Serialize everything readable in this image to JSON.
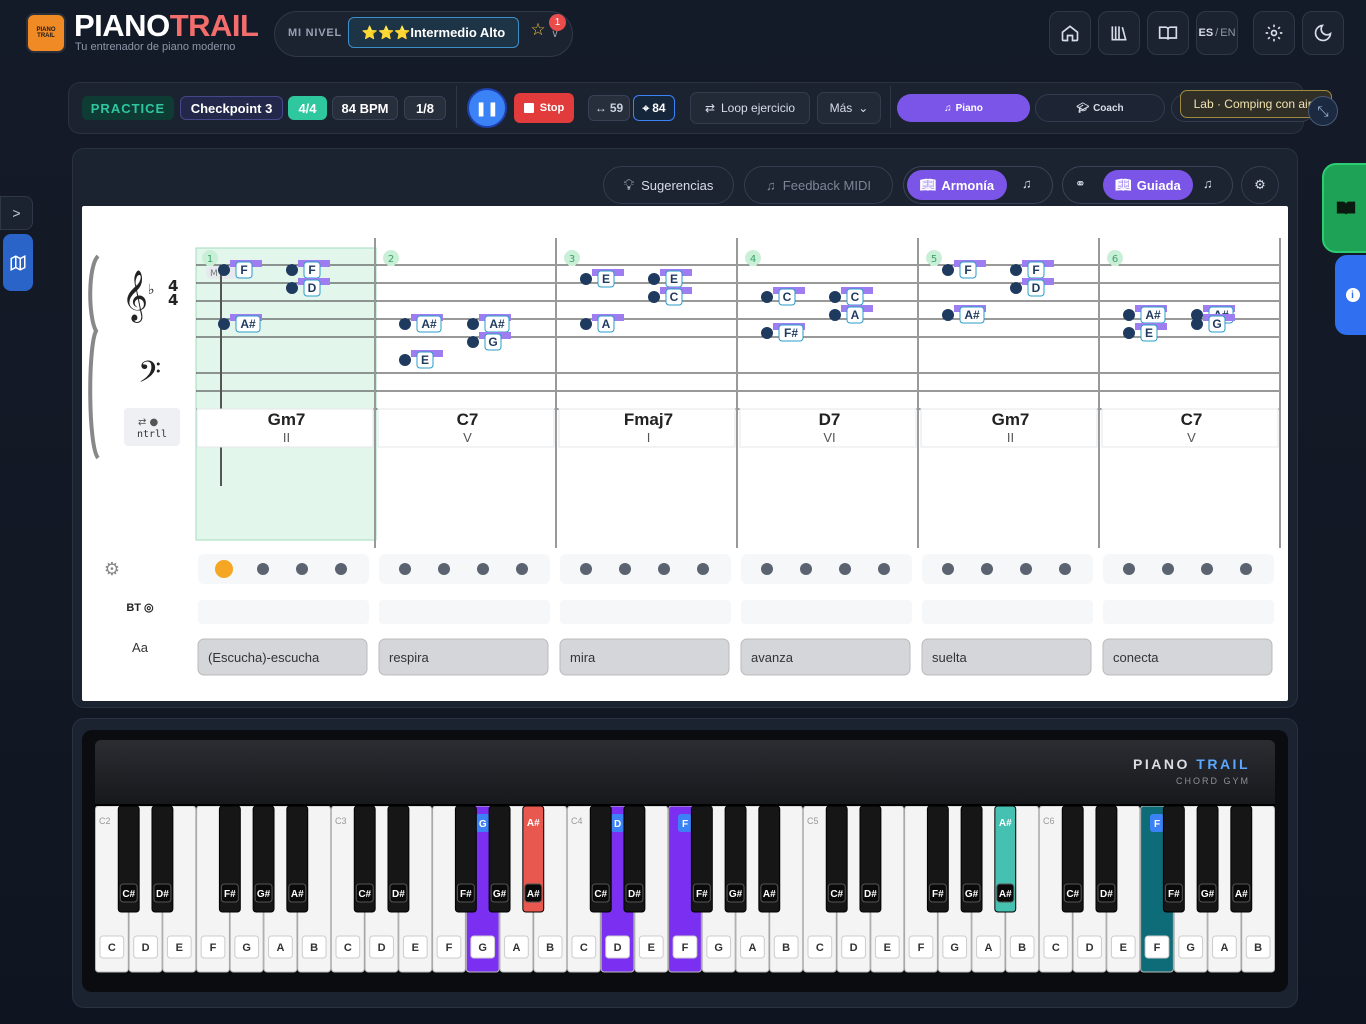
{
  "header": {
    "brand_part1": "PIANO",
    "brand_part2": "TRAIL",
    "logo_text1": "PIANO",
    "logo_text2": "TRAIL",
    "tagline": "Tu entrenador de piano moderno",
    "level_label": "MI NIVEL",
    "level_value": "⭐⭐⭐Intermedio Alto",
    "notification_count": "1",
    "lang_active": "ES",
    "lang_sep": "/",
    "lang_other": "EN",
    "icons": [
      "home-icon",
      "library-icon",
      "book-icon",
      "gear-icon",
      "moon-icon"
    ]
  },
  "transport": {
    "practice": "PRACTICE",
    "checkpoint": "Checkpoint 3",
    "meter": "4/4",
    "bpm": "84 BPM",
    "subdivision": "1/8",
    "stop": "Stop",
    "loop_count": "59",
    "sync_value": "84",
    "loop_label": "Loop ejercicio",
    "more_label": "Más",
    "tabs": [
      "Piano",
      "Coach"
    ],
    "lab_tooltip": "Lab · Comping con aire"
  },
  "filters": {
    "suggestions": "Sugerencias",
    "midi_feedback": "Feedback MIDI",
    "harmony": "Armonía",
    "guided": "Guiada"
  },
  "score": {
    "clef_mode_label": "ntrll",
    "octave_tag": "M",
    "octave_label": "O4",
    "measures": [
      {
        "number": "1",
        "chord": "Gm7",
        "roman": "II",
        "lyric": "(Escucha)-escucha",
        "notes": [
          {
            "label": "F",
            "pos": 0,
            "step": 0
          },
          {
            "label": "F",
            "pos": 1,
            "step": 0
          },
          {
            "label": "D",
            "pos": 1,
            "step": 1
          },
          {
            "label": "A#",
            "pos": 0,
            "step": 3
          }
        ]
      },
      {
        "number": "2",
        "chord": "C7",
        "roman": "V",
        "lyric": "respira",
        "notes": [
          {
            "label": "A#",
            "pos": 0,
            "step": 3
          },
          {
            "label": "E",
            "pos": 0,
            "step": 5
          },
          {
            "label": "A#",
            "pos": 1,
            "step": 3
          },
          {
            "label": "G",
            "pos": 1,
            "step": 4
          }
        ]
      },
      {
        "number": "3",
        "chord": "Fmaj7",
        "roman": "I",
        "lyric": "mira",
        "notes": [
          {
            "label": "E",
            "pos": 0,
            "step": 0.5
          },
          {
            "label": "A",
            "pos": 0,
            "step": 3
          },
          {
            "label": "E",
            "pos": 1,
            "step": 0.5
          },
          {
            "label": "C",
            "pos": 1,
            "step": 1.5
          }
        ]
      },
      {
        "number": "4",
        "chord": "D7",
        "roman": "VI",
        "lyric": "avanza",
        "notes": [
          {
            "label": "C",
            "pos": 0,
            "step": 1.5
          },
          {
            "label": "F#",
            "pos": 0,
            "step": 3.5
          },
          {
            "label": "C",
            "pos": 1,
            "step": 1.5
          },
          {
            "label": "A",
            "pos": 1,
            "step": 2.5
          }
        ]
      },
      {
        "number": "5",
        "chord": "Gm7",
        "roman": "II",
        "lyric": "suelta",
        "notes": [
          {
            "label": "F",
            "pos": 0,
            "step": 0
          },
          {
            "label": "A#",
            "pos": 0,
            "step": 2.5
          },
          {
            "label": "F",
            "pos": 1,
            "step": 0
          },
          {
            "label": "D",
            "pos": 1,
            "step": 1
          }
        ]
      },
      {
        "number": "6",
        "chord": "C7",
        "roman": "V",
        "lyric": "conecta",
        "notes": [
          {
            "label": "A#",
            "pos": 0,
            "step": 2.5
          },
          {
            "label": "E",
            "pos": 0,
            "step": 3.5
          },
          {
            "label": "A#",
            "pos": 1,
            "step": 2.5
          },
          {
            "label": "G",
            "pos": 1,
            "step": 3
          }
        ]
      }
    ],
    "active_beat": {
      "measure": 1,
      "beat": 1
    },
    "bt_label": "BT",
    "lyric_row_label": "Aa"
  },
  "keyboard": {
    "brand_part1": "PIANO",
    "brand_part2": "TRAIL",
    "subtitle": "CHORD GYM",
    "octave_labels": [
      "C2",
      "C3",
      "C4",
      "C5",
      "C6"
    ],
    "white_labels": [
      "C",
      "D",
      "E",
      "F",
      "G",
      "A",
      "B"
    ],
    "black_labels": [
      "C#",
      "D#",
      "F#",
      "G#",
      "A#"
    ],
    "highlights": [
      {
        "key": "G3",
        "label": "G",
        "color": "#7b2ff0"
      },
      {
        "key": "A#3",
        "label": "A#",
        "color": "#e8584e"
      },
      {
        "key": "D4",
        "label": "D",
        "color": "#7b2ff0"
      },
      {
        "key": "F4",
        "label": "F",
        "color": "#7b2ff0"
      },
      {
        "key": "A#5",
        "label": "A#",
        "color": "#46c0b0"
      },
      {
        "key": "F6",
        "label": "F",
        "color": "#0e6b78"
      }
    ]
  }
}
